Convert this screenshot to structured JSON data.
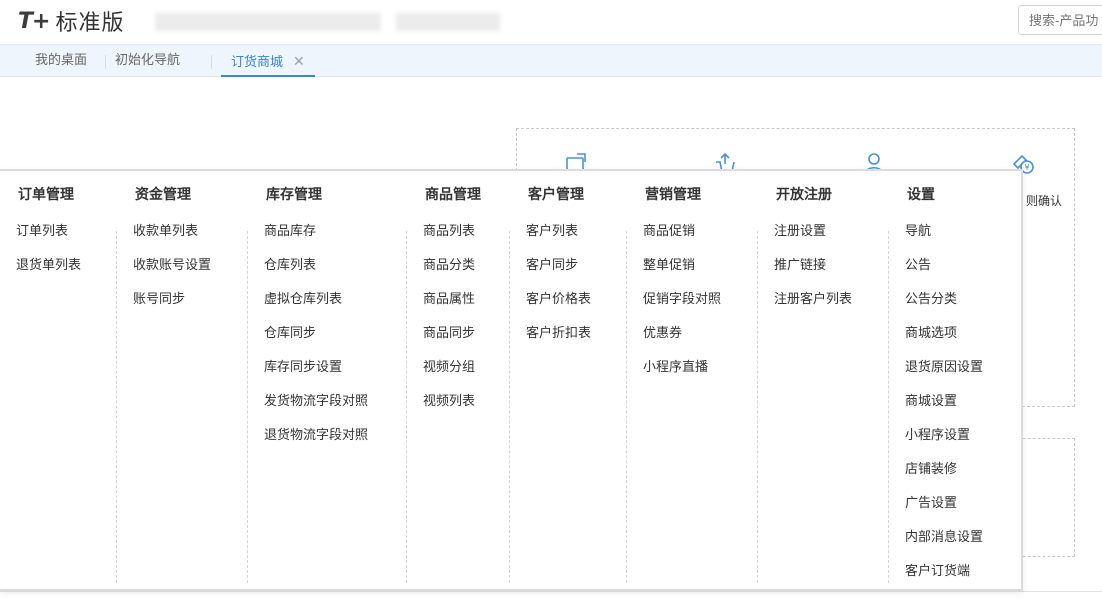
{
  "header": {
    "logo_mark": "T+",
    "logo_text": "标准版",
    "search_placeholder": "搜索-产品功"
  },
  "tabs": [
    {
      "label": "我的桌面"
    },
    {
      "label": "初始化导航"
    },
    {
      "label": "订货商城",
      "active": true
    }
  ],
  "background": {
    "partial_text": "则确认"
  },
  "menu": {
    "columns": [
      {
        "title": "订单管理",
        "items": [
          "订单列表",
          "退货单列表"
        ]
      },
      {
        "title": "资金管理",
        "items": [
          "收款单列表",
          "收款账号设置",
          "账号同步"
        ]
      },
      {
        "title": "库存管理",
        "items": [
          "商品库存",
          "仓库列表",
          "虚拟仓库列表",
          "仓库同步",
          "库存同步设置",
          "发货物流字段对照",
          "退货物流字段对照"
        ]
      },
      {
        "title": "商品管理",
        "items": [
          "商品列表",
          "商品分类",
          "商品属性",
          "商品同步",
          "视频分组",
          "视频列表"
        ]
      },
      {
        "title": "客户管理",
        "items": [
          "客户列表",
          "客户同步",
          "客户价格表",
          "客户折扣表"
        ]
      },
      {
        "title": "营销管理",
        "items": [
          "商品促销",
          "整单促销",
          "促销字段对照",
          "优惠券",
          "小程序直播"
        ]
      },
      {
        "title": "开放注册",
        "items": [
          "注册设置",
          "推广链接",
          "注册客户列表"
        ]
      },
      {
        "title": "设置",
        "items": [
          "导航",
          "公告",
          "公告分类",
          "商城选项",
          "退货原因设置",
          "商城设置",
          "小程序设置",
          "店铺装修",
          "广告设置",
          "内部消息设置",
          "客户订货端"
        ]
      }
    ]
  },
  "colors": {
    "accent": "#3a83d6",
    "tabbar_bg": "#eef5fd",
    "icon_blue": "#4a90d9"
  },
  "icons": [
    "order-icon",
    "cart-icon",
    "user-icon",
    "payment-icon",
    "close-icon"
  ]
}
